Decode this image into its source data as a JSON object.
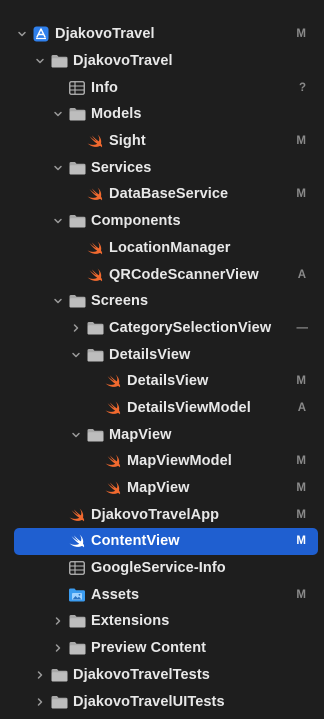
{
  "navigator": {
    "items": [
      {
        "label": "DjakovoTravel",
        "status": "M",
        "icon": "xcode-project-icon",
        "expanded": true
      },
      {
        "label": "DjakovoTravel",
        "status": "",
        "icon": "folder-icon",
        "expanded": true
      },
      {
        "label": "Info",
        "status": "?",
        "icon": "plist-icon"
      },
      {
        "label": "Models",
        "status": "",
        "icon": "folder-icon",
        "expanded": true
      },
      {
        "label": "Sight",
        "status": "M",
        "icon": "swift-file-icon"
      },
      {
        "label": "Services",
        "status": "",
        "icon": "folder-icon",
        "expanded": true
      },
      {
        "label": "DataBaseService",
        "status": "M",
        "icon": "swift-file-icon"
      },
      {
        "label": "Components",
        "status": "",
        "icon": "folder-icon",
        "expanded": true
      },
      {
        "label": "LocationManager",
        "status": "",
        "icon": "swift-file-icon"
      },
      {
        "label": "QRCodeScannerView",
        "status": "A",
        "icon": "swift-file-icon"
      },
      {
        "label": "Screens",
        "status": "",
        "icon": "folder-icon",
        "expanded": true
      },
      {
        "label": "CategorySelectionView",
        "status": "—",
        "icon": "folder-icon",
        "expanded": false
      },
      {
        "label": "DetailsView",
        "status": "",
        "icon": "folder-icon",
        "expanded": true
      },
      {
        "label": "DetailsView",
        "status": "M",
        "icon": "swift-file-icon"
      },
      {
        "label": "DetailsViewModel",
        "status": "A",
        "icon": "swift-file-icon"
      },
      {
        "label": "MapView",
        "status": "",
        "icon": "folder-icon",
        "expanded": true
      },
      {
        "label": "MapViewModel",
        "status": "M",
        "icon": "swift-file-icon"
      },
      {
        "label": "MapView",
        "status": "M",
        "icon": "swift-file-icon"
      },
      {
        "label": "DjakovoTravelApp",
        "status": "M",
        "icon": "swift-file-icon"
      },
      {
        "label": "ContentView",
        "status": "M",
        "icon": "swift-file-icon",
        "selected": true
      },
      {
        "label": "GoogleService-Info",
        "status": "",
        "icon": "plist-icon"
      },
      {
        "label": "Assets",
        "status": "M",
        "icon": "asset-catalog-icon"
      },
      {
        "label": "Extensions",
        "status": "",
        "icon": "folder-icon",
        "expanded": false
      },
      {
        "label": "Preview Content",
        "status": "",
        "icon": "folder-icon",
        "expanded": false
      },
      {
        "label": "DjakovoTravelTests",
        "status": "",
        "icon": "folder-icon",
        "expanded": false
      },
      {
        "label": "DjakovoTravelUITests",
        "status": "",
        "icon": "folder-icon",
        "expanded": false
      }
    ]
  },
  "colors": {
    "background": "#1e1e1e",
    "selection": "#1f5fd0",
    "swift_icon": "#f0692f",
    "folder_icon": "#a8a8a8",
    "project_icon": "#2f80ed"
  }
}
